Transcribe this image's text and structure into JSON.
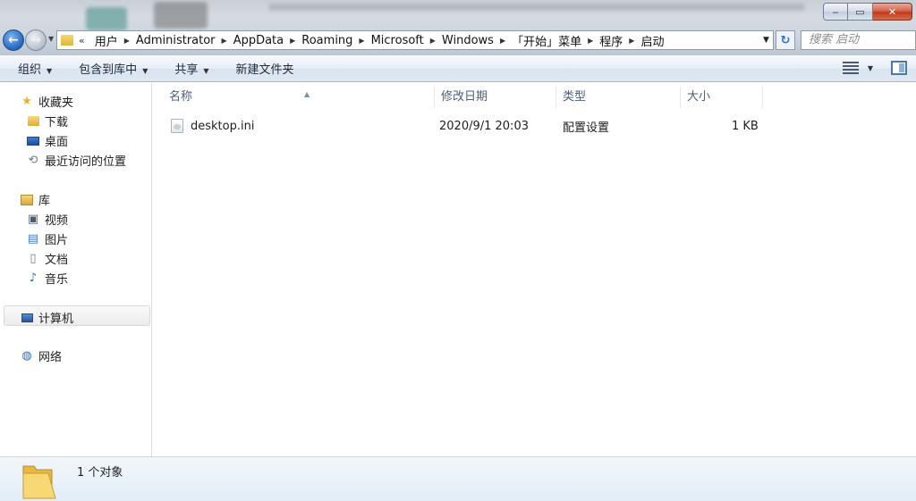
{
  "window": {
    "minimize_glyph": "‒",
    "maximize_glyph": "▭",
    "close_glyph": "✕"
  },
  "address": {
    "lead": "«",
    "crumbs": [
      "用户",
      "Administrator",
      "AppData",
      "Roaming",
      "Microsoft",
      "Windows",
      "「开始」菜单",
      "程序",
      "启动"
    ],
    "search_placeholder": "搜索 启动"
  },
  "toolbar": {
    "organize": "组织",
    "include_in_library": "包含到库中",
    "share": "共享",
    "new_folder": "新建文件夹"
  },
  "navpane": {
    "favorites": "收藏夹",
    "downloads": "下载",
    "desktop": "桌面",
    "recent": "最近访问的位置",
    "libraries": "库",
    "videos": "视频",
    "pictures": "图片",
    "documents": "文档",
    "music": "音乐",
    "computer": "计算机",
    "network": "网络"
  },
  "columns": {
    "name": "名称",
    "date_modified": "修改日期",
    "type": "类型",
    "size": "大小"
  },
  "files": [
    {
      "name": "desktop.ini",
      "date_modified": "2020/9/1 20:03",
      "type": "配置设置",
      "size": "1 KB"
    }
  ],
  "status": {
    "count": "1 个对象"
  },
  "colors": {
    "accent": "#2f70c8",
    "column_header_text": "#4c607a",
    "toolbar_bg": "#dfe8f2"
  }
}
